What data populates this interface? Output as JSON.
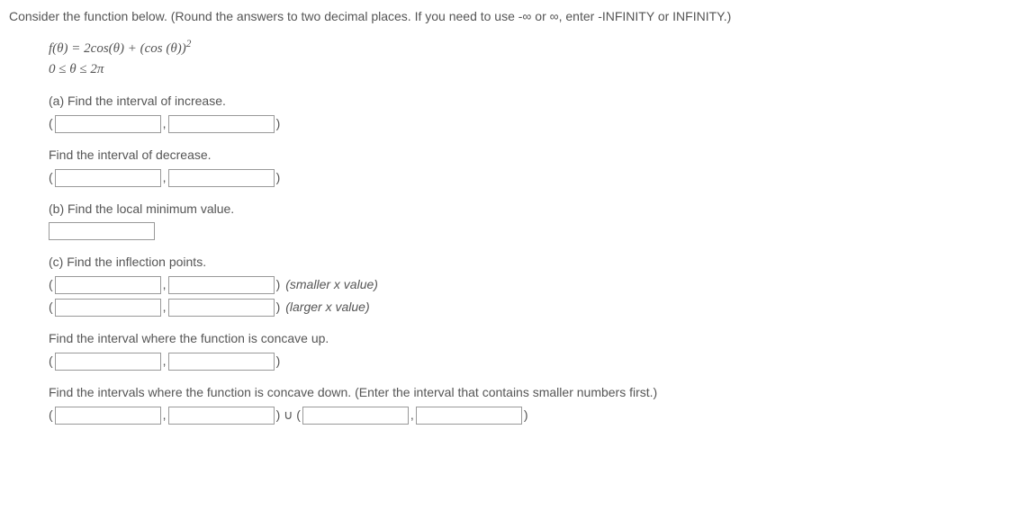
{
  "intro": "Consider the function below. (Round the answers to two decimal places. If you need to use -∞ or ∞, enter -INFINITY or INFINITY.)",
  "formula_plain": "f(θ) = 2cos(θ) + (cos (θ))²",
  "domain_line": "0 ≤ θ ≤ 2π",
  "parts": {
    "a": {
      "increase_label": "(a) Find the interval of increase.",
      "decrease_label": "Find the interval of decrease."
    },
    "b": {
      "label": "(b) Find the local minimum value."
    },
    "c": {
      "inflection_label": "(c) Find the inflection points.",
      "smaller_note": "(smaller x value)",
      "larger_note": "(larger x value)",
      "concave_up_label": "Find the interval where the function is concave up.",
      "concave_down_label": "Find the intervals where the function is concave down. (Enter the interval that contains smaller numbers first.)"
    }
  },
  "punct": {
    "open": "(",
    "close": ")",
    "comma": ",",
    "union_seg": ") ∪ ("
  }
}
